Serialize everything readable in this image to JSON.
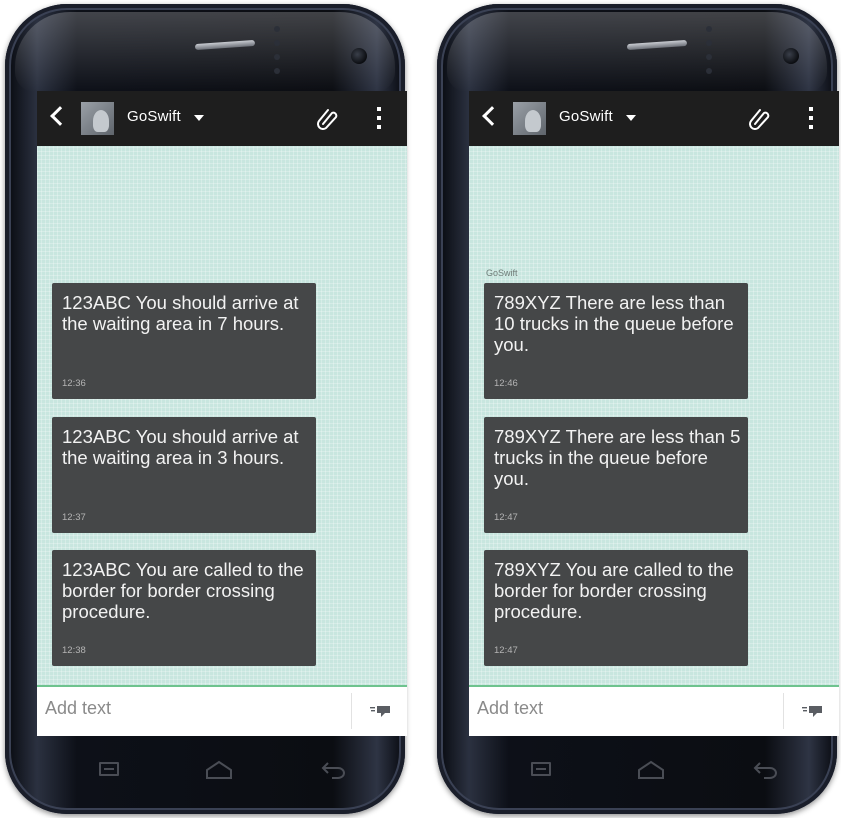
{
  "colors": {
    "app_bar": "#1e1e1e",
    "screen_background": "#c8e6df",
    "bubble": "#454748",
    "compose_border": "#6ec38e"
  },
  "icons": {
    "back": "back-chevron-icon",
    "avatar": "contact-avatar",
    "dropdown": "caret-down-icon",
    "attach": "paperclip-icon",
    "menu": "overflow-menu-icon",
    "send": "send-icon",
    "nav_recent": "recent-apps-icon",
    "nav_home": "home-icon",
    "nav_back": "back-icon"
  },
  "left_phone": {
    "contact_name": "GoSwift",
    "compose_placeholder": "Add text",
    "messages": [
      {
        "text": "123ABC You should arrive at the waiting area in 7 hours.",
        "time": "12:36"
      },
      {
        "text": "123ABC You should arrive at the waiting area in 3 hours.",
        "time": "12:37"
      },
      {
        "text": "123ABC You are called to the border for border crossing procedure.",
        "time": "12:38"
      }
    ]
  },
  "right_phone": {
    "contact_name": "GoSwift",
    "sender_label": "GoSwift",
    "compose_placeholder": "Add text",
    "messages": [
      {
        "text": "789XYZ There are less than 10 trucks in the queue before you.",
        "time": "12:46"
      },
      {
        "text": "789XYZ There are less than 5 trucks in the queue before you.",
        "time": "12:47"
      },
      {
        "text": "789XYZ You are called to the border for border crossing procedure.",
        "time": "12:47"
      }
    ]
  }
}
